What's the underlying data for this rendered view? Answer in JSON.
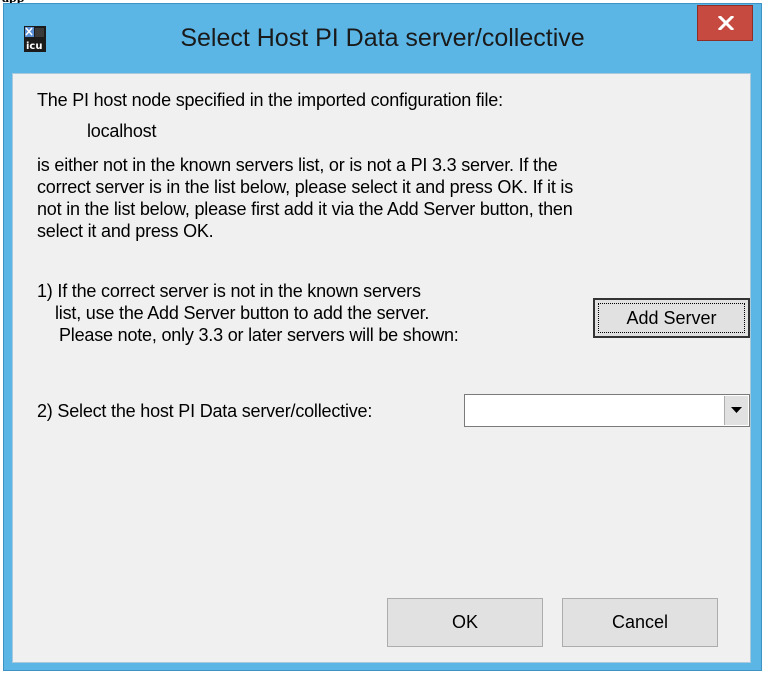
{
  "window": {
    "title": "Select Host PI Data server/collective",
    "app_icon": "icu-app-icon",
    "close_icon": "close-icon"
  },
  "message": {
    "line1": "The PI host node specified in the imported configuration file:",
    "host": "localhost",
    "para_lines": [
      "is either not in the known servers list, or is not a PI 3.3 server. If the",
      "correct server is in the list below, please select it and press OK. If it is",
      "not in the list below, please first add it via the Add Server button, then",
      "select it and press OK."
    ]
  },
  "step1": {
    "lines": [
      "1) If the correct server is not in the known servers",
      "list, use the Add Server button to add the server.",
      "Please note, only 3.3 or later servers will be shown:"
    ],
    "add_server_label": "Add Server"
  },
  "step2": {
    "label": "2) Select the host PI Data server/collective:",
    "selected_value": ""
  },
  "buttons": {
    "ok": "OK",
    "cancel": "Cancel"
  },
  "colors": {
    "frame": "#5bb6e6",
    "close": "#c74a40",
    "client": "#f0f0f0"
  }
}
